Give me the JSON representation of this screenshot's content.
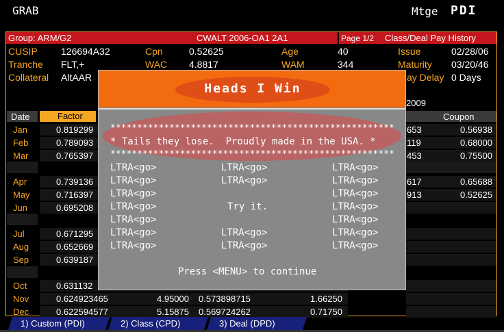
{
  "header": {
    "left": "GRAB",
    "mtge": "Mtge",
    "function": "PDI"
  },
  "redbar": {
    "group": "Group:  ARM/G2",
    "deal": "CWALT 2006-OA1 2A1",
    "page": "Page 1/2",
    "title": "Class/Deal Pay History"
  },
  "info": {
    "cusip_label": "CUSIP",
    "cusip": "126694A32",
    "cpn_label": "Cpn",
    "cpn": "0.52625",
    "age_label": "Age",
    "age": "40",
    "issue_label": "Issue",
    "issue": "02/28/06",
    "tranche_label": "Tranche",
    "tranche": "FLT,+",
    "wac_label": "WAC",
    "wac": "4.8817",
    "wam_label": "WAM",
    "wam": "344",
    "maturity_label": "Maturity",
    "maturity": "03/20/46",
    "collateral_label": "Collateral",
    "collateral": "AltAAR",
    "paydelay_label": "ay Delay",
    "paydelay": "0 Days"
  },
  "table": {
    "year": "2009",
    "date_header": "Date",
    "factor_header": "Factor",
    "coupon_header": "Coupon",
    "rows": [
      {
        "month": "Jan",
        "factor": "0.819299",
        "c2": "",
        "c3": "",
        "pfx": "653",
        "coupon": "0.56938"
      },
      {
        "month": "Feb",
        "factor": "0.789093",
        "c2": "",
        "c3": "",
        "pfx": "119",
        "coupon": "0.68000"
      },
      {
        "month": "Mar",
        "factor": "0.765397",
        "c2": "",
        "c3": "",
        "pfx": "453",
        "coupon": "0.75500"
      },
      {
        "month": "Apr",
        "factor": "0.739136",
        "c2": "",
        "c3": "",
        "pfx": "617",
        "coupon": "0.65688"
      },
      {
        "month": "May",
        "factor": "0.716397",
        "c2": "",
        "c3": "",
        "pfx": "913",
        "coupon": "0.52625"
      },
      {
        "month": "Jun",
        "factor": "0.695208",
        "c2": "",
        "c3": "",
        "pfx": "",
        "coupon": ""
      },
      {
        "month": "Jul",
        "factor": "0.671295",
        "c2": "",
        "c3": "",
        "pfx": "",
        "coupon": ""
      },
      {
        "month": "Aug",
        "factor": "0.652669",
        "c2": "",
        "c3": "",
        "pfx": "",
        "coupon": ""
      },
      {
        "month": "Sep",
        "factor": "0.639187",
        "c2": "",
        "c3": "",
        "pfx": "",
        "coupon": ""
      },
      {
        "month": "Oct",
        "factor": "0.631132",
        "c2": "",
        "c3": "",
        "pfx": "",
        "coupon": ""
      },
      {
        "month": "Nov",
        "factor": "0.624923465",
        "c2": "4.95000",
        "c3": "0.573898715",
        "c4": "1.66250"
      },
      {
        "month": "Dec",
        "factor": "0.622594577",
        "c2": "5.15875",
        "c3": "0.569724262",
        "c4": "0.71750"
      }
    ]
  },
  "dialog": {
    "title": "Heads I Win",
    "stars1": "*****************************************************",
    "tagline": "* Tails they lose.  Proudly made in the USA. *",
    "stars2": "*****************************************************",
    "ltra": "LTRA<go>",
    "tryit": "Try it.",
    "continue": "Press <MENU> to continue"
  },
  "tabs": [
    "1)  Custom (PDI)",
    "2)  Class (CPD)",
    "3)  Deal (DPD)"
  ]
}
